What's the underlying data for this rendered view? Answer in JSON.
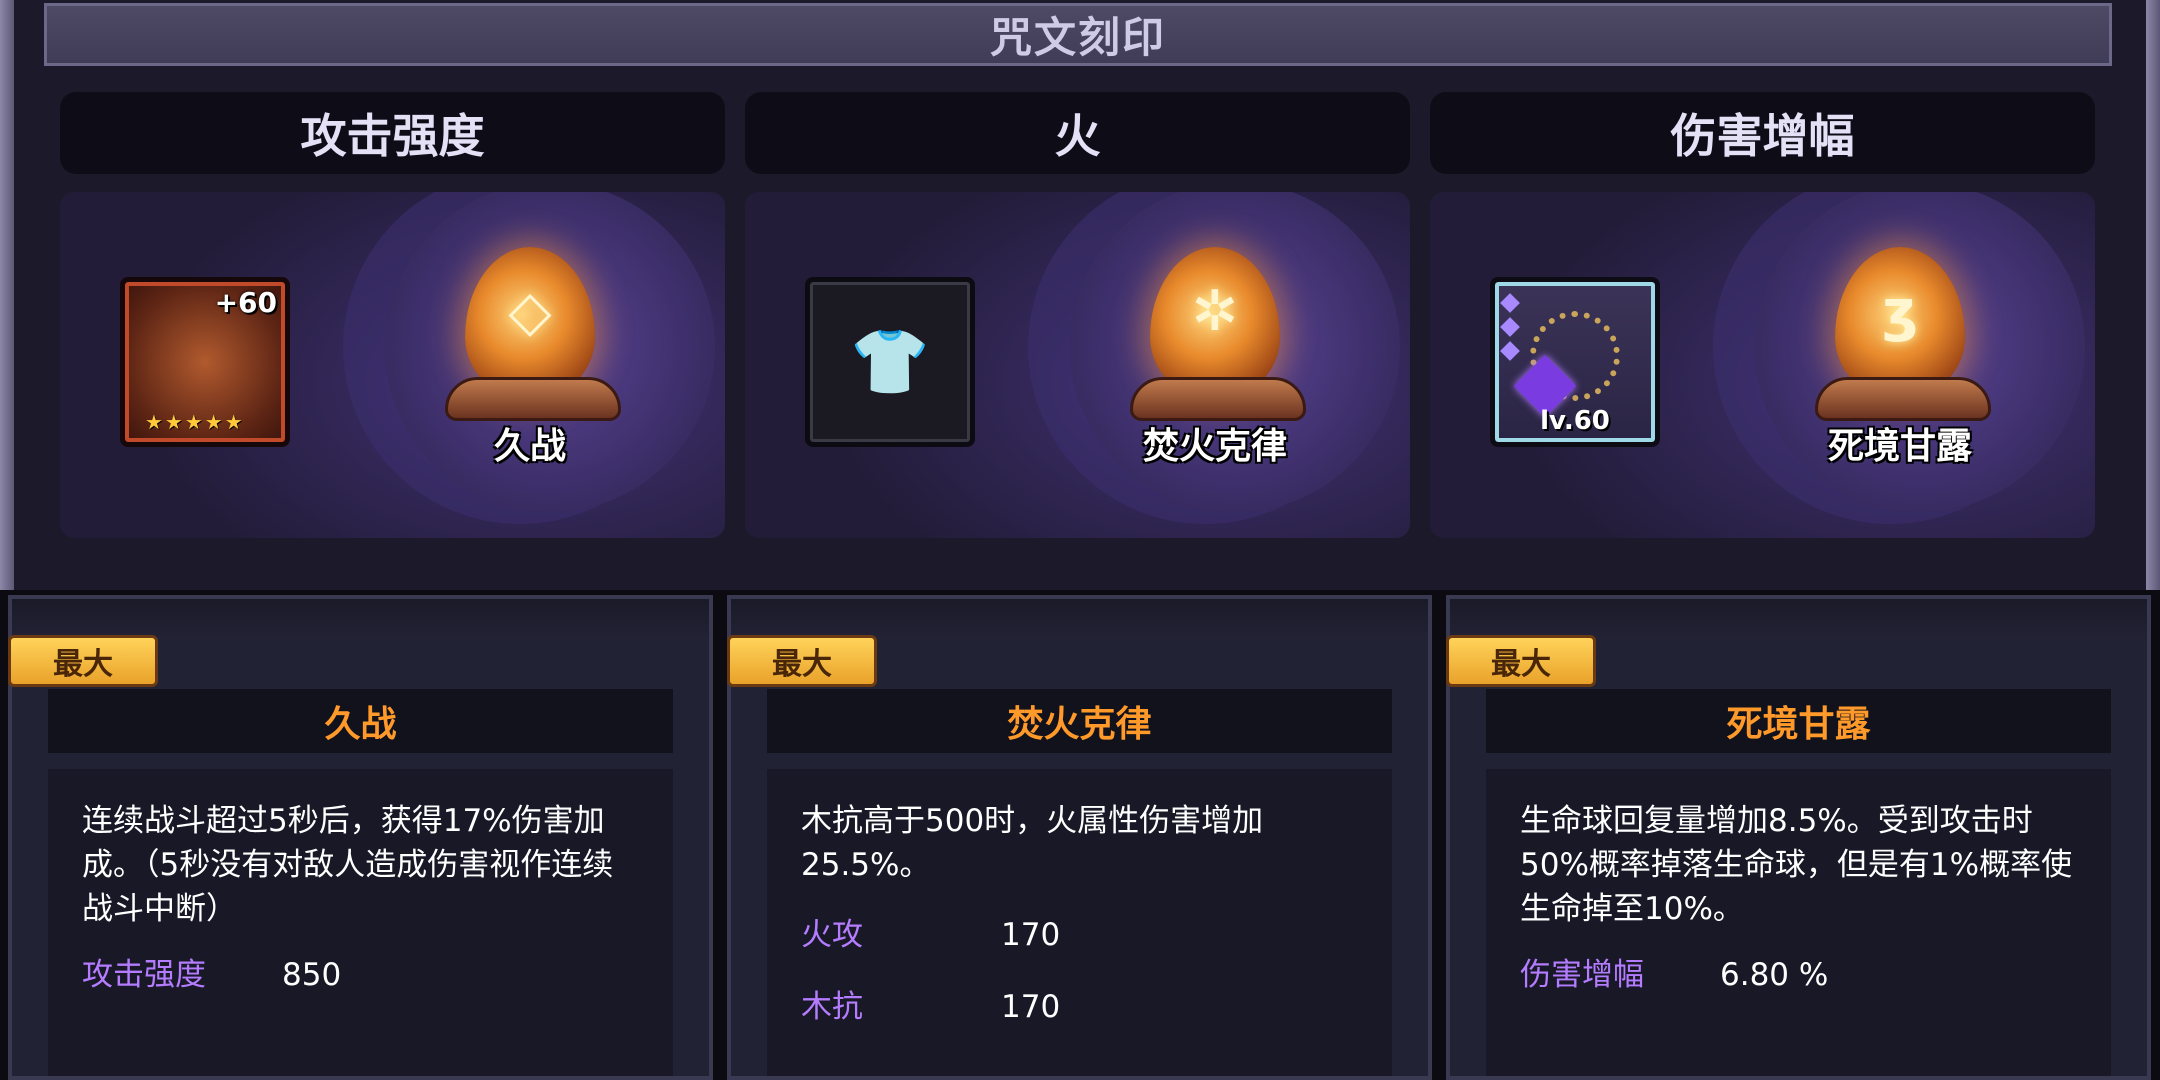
{
  "title": "咒文刻印",
  "panels": [
    {
      "category": "攻击强度",
      "item_plus": "+60",
      "rune_name": "久战"
    },
    {
      "category": "火",
      "rune_name": "焚火克律"
    },
    {
      "category": "伤害增幅",
      "item_level": "lv.60",
      "rune_name": "死境甘露"
    }
  ],
  "cards": [
    {
      "badge": "最大",
      "name": "久战",
      "description": "连续战斗超过5秒后，获得17%伤害加成。（5秒没有对敌人造成伤害视作连续战斗中断）",
      "stats": [
        {
          "label": "攻击强度",
          "value": "850"
        }
      ]
    },
    {
      "badge": "最大",
      "name": "焚火克律",
      "description": "木抗高于500时，火属性伤害增加25.5%。",
      "stats": [
        {
          "label": "火攻",
          "value": "170"
        },
        {
          "label": "木抗",
          "value": "170"
        }
      ]
    },
    {
      "badge": "最大",
      "name": "死境甘露",
      "description": "生命球回复量增加8.5%。受到攻击时50%概率掉落生命球，但是有1%概率使生命掉至10%。",
      "stats": [
        {
          "label": "伤害增幅",
          "value": "6.80 %"
        }
      ]
    }
  ],
  "icons": [
    "stamina-rune-icon",
    "fire-rune-icon",
    "death-rune-icon",
    "armor-slot-icon",
    "necklace-icon",
    "weapon-icon",
    "star-icon"
  ],
  "colors": {
    "accent_orange": "#ff9a2a",
    "stat_purple": "#b47cff",
    "badge_gold": "#ffd35a"
  }
}
